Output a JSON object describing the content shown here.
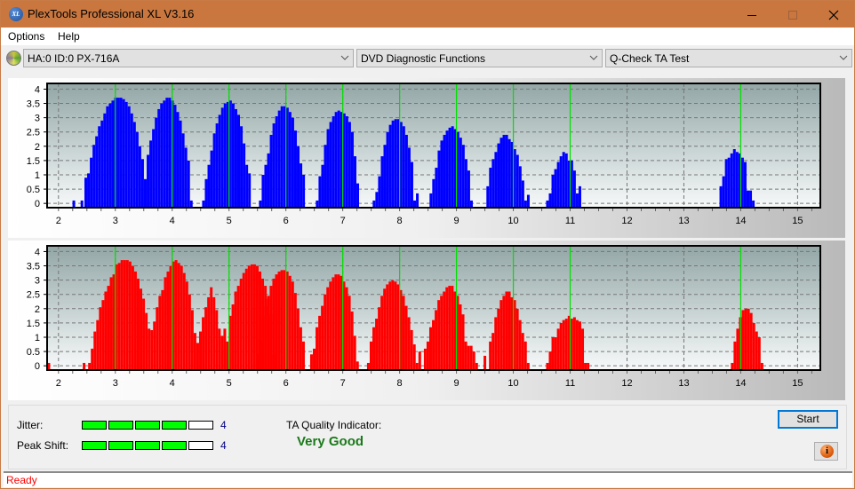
{
  "window": {
    "title": "PlexTools Professional XL V3.16",
    "app_icon_label": "XL",
    "controls": [
      "minimize",
      "maximize",
      "close"
    ]
  },
  "menu": {
    "items": [
      "Options",
      "Help"
    ]
  },
  "toolbar": {
    "drive": "HA:0 ID:0  PX-716A",
    "function_group": "DVD Diagnostic Functions",
    "test": "Q-Check TA Test"
  },
  "colors": {
    "titlebar": "#c9773f",
    "jitter_bars": "#0000ff",
    "peakshift_bars": "#ff0000",
    "marker_lines": "#00e000",
    "meter_on": "#00ff00",
    "quality_text": "#1a7a1a",
    "status_text": "#ff0000"
  },
  "chart_data": [
    {
      "name": "jitter-distribution",
      "type": "bar",
      "color": "#0000ff",
      "xlim": [
        1.8,
        15.4
      ],
      "ylim": [
        -0.15,
        4.2
      ],
      "xticks": [
        2,
        3,
        4,
        5,
        6,
        7,
        8,
        9,
        10,
        11,
        12,
        13,
        14,
        15
      ],
      "yticks": [
        0,
        0.5,
        1,
        1.5,
        2,
        2.5,
        3,
        3.5,
        4
      ],
      "ytick_labels": [
        "0",
        "0.5",
        "1",
        "1.5",
        "2",
        "2.5",
        "3",
        "3.5",
        "4"
      ],
      "markers": [
        3,
        4,
        5,
        6,
        7,
        8,
        9,
        10,
        11,
        14
      ],
      "grid": true,
      "bar_pitch": 0.0476,
      "peaks": [
        {
          "start": 2.27,
          "values": [
            0.1,
            0,
            0,
            0.1
          ]
        },
        {
          "start": 2.48,
          "values": [
            0.9,
            1.05,
            1.6,
            2.05,
            2.35,
            2.7,
            2.9,
            3.15,
            3.4,
            3.5,
            3.6,
            3.7,
            3.7,
            3.7,
            3.65,
            3.55,
            3.4,
            3.15,
            2.85,
            2.5,
            2.0,
            1.55,
            0.85,
            1.7,
            2.2,
            2.6,
            3.0,
            3.3,
            3.5,
            3.6,
            3.7,
            3.7,
            3.6,
            3.45,
            3.2,
            2.9,
            2.45,
            1.95,
            1.5,
            0.1
          ]
        },
        {
          "start": 4.55,
          "values": [
            0.1,
            0.85,
            1.35,
            1.85,
            2.45,
            2.8,
            3.1,
            3.35,
            3.5,
            3.55,
            3.6,
            3.5,
            3.3,
            3.1,
            2.7,
            2.1,
            1.35,
            1.05
          ]
        },
        {
          "start": 5.55,
          "values": [
            0.1,
            1.0,
            1.35,
            1.75,
            2.4,
            2.8,
            3.05,
            3.25,
            3.4,
            3.4,
            3.35,
            3.2,
            3.0,
            2.55,
            2.0,
            1.4,
            1.0
          ]
        },
        {
          "start": 6.55,
          "values": [
            0.1,
            0.95,
            1.35,
            2.05,
            2.6,
            2.85,
            3.05,
            3.2,
            3.25,
            3.2,
            3.15,
            3.05,
            2.85,
            2.5,
            1.65,
            0.7
          ]
        },
        {
          "start": 7.55,
          "values": [
            0.1,
            0.4,
            0.95,
            1.65,
            2.05,
            2.5,
            2.75,
            2.9,
            2.95,
            2.95,
            2.85,
            2.7,
            2.4,
            1.95,
            1.45,
            0.1,
            0.35
          ]
        },
        {
          "start": 8.55,
          "values": [
            0.35,
            0.85,
            1.25,
            1.85,
            2.2,
            2.4,
            2.55,
            2.65,
            2.7,
            2.6,
            2.5,
            2.3,
            2.05,
            1.55,
            1.15,
            0.1
          ]
        },
        {
          "start": 9.55,
          "values": [
            0.6,
            1.25,
            1.55,
            1.8,
            2.1,
            2.3,
            2.4,
            2.4,
            2.25,
            2.15,
            1.9,
            1.7,
            1.3,
            0.8,
            0.1,
            0.3
          ]
        },
        {
          "start": 10.6,
          "values": [
            0.1,
            0.35,
            1.0,
            1.2,
            1.45,
            1.65,
            1.8,
            1.75,
            1.5,
            1.5,
            1.15,
            0.35,
            0.6
          ]
        },
        {
          "start": 13.65,
          "values": [
            0.6,
            0.95,
            1.55,
            1.6,
            1.75,
            1.9,
            1.8,
            1.75,
            1.6,
            1.45,
            0.45,
            0.45,
            0.1
          ]
        }
      ]
    },
    {
      "name": "peak-shift-distribution",
      "type": "bar",
      "color": "#ff0000",
      "xlim": [
        1.8,
        15.4
      ],
      "ylim": [
        -0.15,
        4.2
      ],
      "xticks": [
        2,
        3,
        4,
        5,
        6,
        7,
        8,
        9,
        10,
        11,
        12,
        13,
        14,
        15
      ],
      "yticks": [
        0,
        0.5,
        1,
        1.5,
        2,
        2.5,
        3,
        3.5,
        4
      ],
      "ytick_labels": [
        "0",
        "0.5",
        "1",
        "1.5",
        "2",
        "2.5",
        "3",
        "3.5",
        "4"
      ],
      "markers": [
        3,
        4,
        5,
        6,
        7,
        8,
        9,
        10,
        11,
        14
      ],
      "grid": true,
      "bar_pitch": 0.0476,
      "peaks": [
        {
          "start": 1.83,
          "values": [
            0.1
          ]
        },
        {
          "start": 2.45,
          "values": [
            0.1,
            0,
            0.1,
            0.6,
            1.2,
            1.6,
            2.05,
            2.3,
            2.6,
            2.8,
            3.1,
            3.2,
            3.55,
            3.6,
            3.7,
            3.7,
            3.7,
            3.65,
            3.5,
            3.3,
            3.05,
            2.7,
            2.35,
            1.85,
            1.3,
            1.25,
            1.55,
            2.05,
            2.45,
            2.65,
            3.1,
            3.3,
            3.5,
            3.65,
            3.7,
            3.6,
            3.5,
            3.25,
            2.95,
            2.5,
            1.95,
            1.15,
            0.8,
            1.2,
            1.7,
            2.05,
            2.4,
            2.75,
            2.4,
            1.95,
            1.3,
            1.05,
            1.3,
            0.85,
            1.75,
            2.15,
            2.6,
            2.8,
            3.05,
            3.25,
            3.4,
            3.5,
            3.55,
            3.55,
            3.5,
            3.3,
            3.05,
            2.8,
            2.35,
            1.8,
            0.4,
            0.5
          ]
        },
        {
          "start": 5.5,
          "values": [
            0.4,
            0.9,
            1.75,
            2.1,
            2.45,
            2.8,
            3.05,
            3.2,
            3.3,
            3.35,
            3.35,
            3.3,
            3.15,
            2.95,
            2.55,
            2.0,
            1.35,
            0.85
          ]
        },
        {
          "start": 6.45,
          "values": [
            0.4,
            0.6,
            1.35,
            1.75,
            2.1,
            2.5,
            2.75,
            2.95,
            3.1,
            3.2,
            3.2,
            3.15,
            2.95,
            2.75,
            2.45,
            1.9,
            1.05,
            0.15
          ]
        },
        {
          "start": 7.45,
          "values": [
            0.1,
            0.85,
            1.35,
            1.65,
            2.05,
            2.45,
            2.7,
            2.85,
            2.95,
            3.0,
            2.95,
            2.85,
            2.65,
            2.45,
            2.1,
            1.7,
            1.25,
            0.75,
            0.1,
            0.5
          ]
        },
        {
          "start": 8.45,
          "values": [
            0.6,
            0.85,
            1.35,
            1.6,
            1.95,
            2.3,
            2.45,
            2.6,
            2.75,
            2.8,
            2.8,
            2.6,
            2.45,
            2.15,
            1.8,
            0.85,
            0.7,
            0.7,
            0.5,
            0.1
          ]
        },
        {
          "start": 9.5,
          "values": [
            0.35,
            0,
            0.85,
            1.15,
            1.7,
            2.0,
            2.3,
            2.45,
            2.6,
            2.6,
            2.4,
            2.3,
            2.0,
            1.6,
            1.15,
            0.85,
            0.1
          ]
        },
        {
          "start": 10.6,
          "values": [
            0.1,
            0.5,
            1.0,
            1.0,
            1.3,
            1.5,
            1.6,
            1.65,
            1.75,
            1.65,
            1.7,
            1.6,
            1.55,
            1.3,
            0.1,
            0.1
          ]
        },
        {
          "start": 13.85,
          "values": [
            0.1,
            0.85,
            1.3,
            1.7,
            1.95,
            2.0,
            2.0,
            1.85,
            1.5,
            1.2,
            1.0,
            0.1
          ]
        }
      ]
    }
  ],
  "metrics": {
    "jitter": {
      "label": "Jitter:",
      "value": "4",
      "level": 4,
      "max": 5
    },
    "peak_shift": {
      "label": "Peak Shift:",
      "value": "4",
      "level": 4,
      "max": 5
    }
  },
  "quality": {
    "label": "TA Quality Indicator:",
    "value": "Very Good"
  },
  "buttons": {
    "start": "Start",
    "info": "i"
  },
  "status": {
    "text": "Ready"
  }
}
